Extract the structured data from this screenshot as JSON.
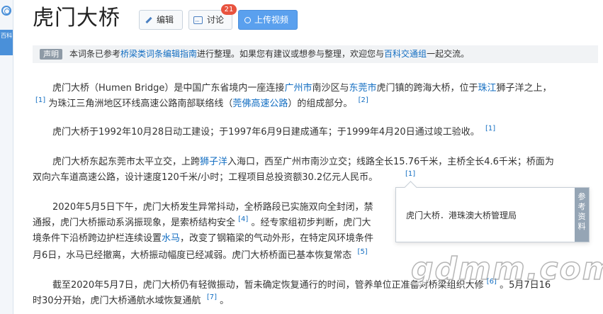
{
  "page": {
    "title": "虎门大桥",
    "side_tag": "百科"
  },
  "toolbar": {
    "edit_label": "编辑",
    "discuss_label": "讨论",
    "discuss_count": "21",
    "upload_label": "上传视频"
  },
  "notice": {
    "tag": "声明",
    "text_before": "本词条已参考",
    "link1": "桥梁类词条编辑指南",
    "text_mid": "进行整理。如果您有建议或想参与整理，欢迎您与",
    "link2": "百科交通组",
    "text_after": "一起交流。"
  },
  "p1": {
    "line1_a": "虎门大桥（Humen Bridge）是中国广东省境内一座连接",
    "line1_link1": "广州市",
    "line1_b": "南沙区与",
    "line1_link2": "东莞市",
    "line1_c": "虎门镇的跨海大桥，位于",
    "line1_link3": "珠江",
    "line1_d": "狮子洋之上，",
    "line2_ref": "[1]",
    "line2_a": "为珠江三角洲地区环线高速公路南部联络线（",
    "line2_link": "莞佛高速公路",
    "line2_b": "）的组成部分。",
    "line2_ref2": "[2]"
  },
  "p2": {
    "text": "虎门大桥于1992年10月28日动工建设；于1997年6月9日建成通车；于1999年4月20日通过竣工验收。",
    "ref": "[1]"
  },
  "p3": {
    "line1_a": "虎门大桥东起东莞市太平立交，上跨",
    "line1_link": "狮子洋",
    "line1_b": "入海口，西至广州市南沙立交；线路全长15.76千米，主桥全长4.6千米；桥面为",
    "line2": "双向六车道高速公路，设计速度120千米/小时；工程项目总投资额30.2亿元人民币。",
    "ref": "[1]"
  },
  "p4": {
    "line1": "2020年5月5日下午，虎门大桥发生异常抖动，全桥路段已实施双向全封闭，禁",
    "line2_a": "通报，虎门大桥振动系涡振现象，是索桥结构安全",
    "line2_ref": "[4]",
    "line2_b": "。经专家组初步判断，虎门大",
    "line3_a": "境条件下沿桥跨边护栏连续设置",
    "line3_link": "水马",
    "line3_b": "，改变了钢箱梁的气动外形，在特定风环境条件",
    "line4": "月6日，水马已经撤离，大桥振动幅度已经减弱。虎门大桥桥面已基本恢复常态",
    "line4_ref": "[5]"
  },
  "p5": {
    "line1": "截至2020年5月7日，虎门大桥仍有轻微振动，暂未确定恢复通行的时间，管养单位正准备对桥梁组织大修",
    "line1_ref": "[6]",
    "line1_b": "。5月7日16",
    "line2": "时30分开始，虎门大桥通航水域恢复通航",
    "line2_ref": "[7]",
    "line2_b": "。"
  },
  "popup": {
    "text": "虎门大桥．港珠澳大桥管理局",
    "side_label": "参考资料"
  },
  "watermark": "gdmm.com"
}
